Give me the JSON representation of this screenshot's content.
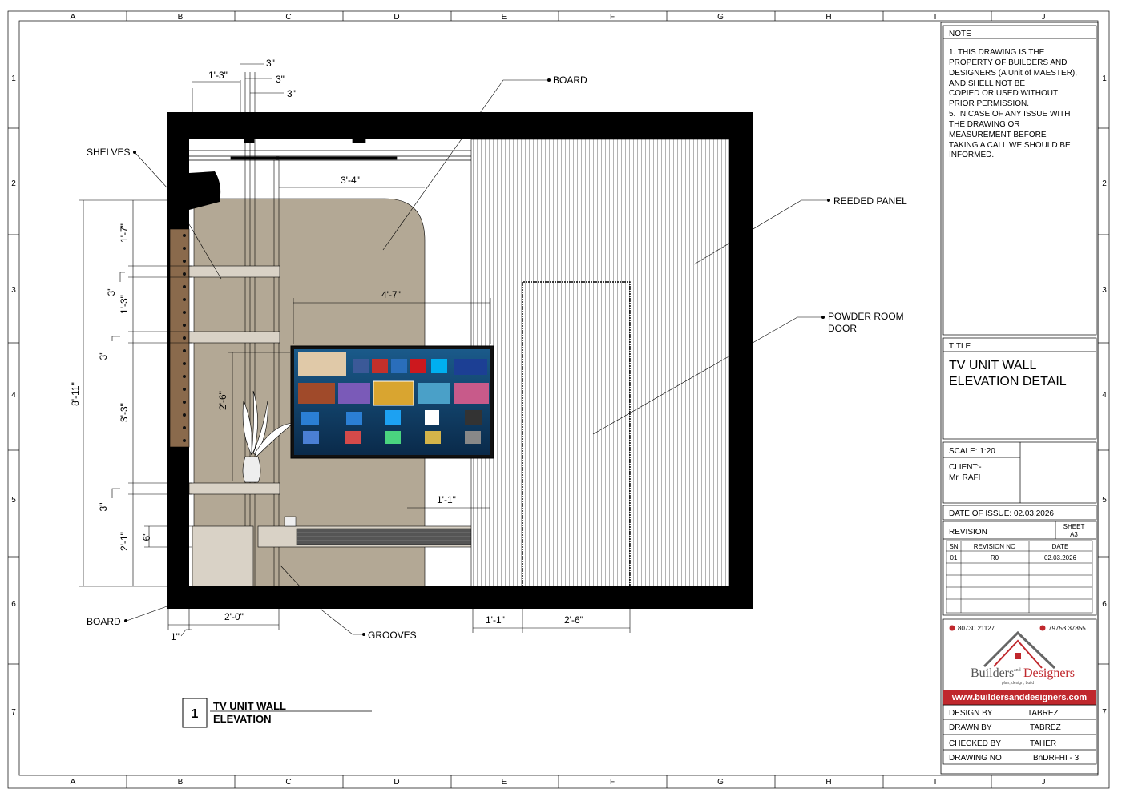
{
  "grid": {
    "columns": [
      "A",
      "B",
      "C",
      "D",
      "E",
      "F",
      "G",
      "H",
      "I",
      "J"
    ],
    "rows": [
      "1",
      "2",
      "3",
      "4",
      "5",
      "6",
      "7"
    ]
  },
  "note": {
    "heading": "NOTE",
    "lines": [
      "1. THIS DRAWING IS THE",
      "PROPERTY OF BUILDERS AND",
      "DESIGNERS (A Unit of MAESTER),",
      "AND SHELL NOT BE",
      "COPIED OR USED WITHOUT",
      "PRIOR PERMISSION.",
      "5. IN CASE OF ANY ISSUE WITH",
      "THE DRAWING OR",
      "MEASUREMENT BEFORE",
      "TAKING A CALL WE SHOULD BE",
      "INFORMED."
    ]
  },
  "title_block": {
    "title_heading": "TITLE",
    "title_line1": "TV UNIT WALL",
    "title_line2": "ELEVATION DETAIL",
    "scale": "SCALE:  1:20",
    "client_label": "CLIENT:-",
    "client_name": "Mr. RAFI",
    "date_of_issue": "DATE OF ISSUE:  02.03.2026",
    "revision_label": "REVISION",
    "sheet_label": "SHEET",
    "sheet_value": "A3",
    "revision_table": {
      "headers": [
        "SN",
        "REVISION NO",
        "DATE"
      ],
      "rows": [
        [
          "01",
          "R0",
          "02.03.2026"
        ]
      ]
    },
    "phone_left": "80730 21127",
    "phone_right": "79753 37855",
    "logo_text_builders": "Builders",
    "logo_text_and": "and",
    "logo_text_designers": "Designers",
    "logo_tagline": "plan, design, build",
    "website": "www.buildersanddesigners.com",
    "design_by_label": "DESIGN BY",
    "design_by": "TABREZ",
    "drawn_by_label": "DRAWN BY",
    "drawn_by": "TABREZ",
    "checked_by_label": "CHECKED BY",
    "checked_by": "TAHER",
    "drawing_no_label": "DRAWING NO",
    "drawing_no": "BnDRFHI - 3",
    "brand_red": "#c0282d"
  },
  "drawing": {
    "view_number": "1",
    "view_title_line1": "TV UNIT WALL",
    "view_title_line2": "ELEVATION",
    "labels": {
      "board_top": "BOARD",
      "shelves": "SHELVES",
      "reeded_panel": "REEDED PANEL",
      "powder_room_door_1": "POWDER ROOM",
      "powder_room_door_2": "DOOR",
      "board_bottom": "BOARD",
      "grooves": "GROOVES"
    },
    "dimensions": {
      "d_1_3": "1'-3\"",
      "d_3a": "3\"",
      "d_3b": "3\"",
      "d_3c": "3\"",
      "d_3_4": "3'-4\"",
      "d_8_11": "8'-11\"",
      "d_1_7": "1'-7\"",
      "d_3d": "3\"",
      "d_1_3v": "1'-3\"",
      "d_3e": "3\"",
      "d_3_3": "3'-3\"",
      "d_3f": "3\"",
      "d_2_1": "2'-1\"",
      "d_6": "6\"",
      "d_2_6v": "2'-6\"",
      "d_4_7": "4'-7\"",
      "d_1_1": "1'-1\"",
      "d_2_0": "2'-0\"",
      "d_1in": "1\"",
      "d_1_1b": "1'-1\"",
      "d_2_6b": "2'-6\""
    },
    "colors": {
      "wall": "#000000",
      "panel_board": "#b3a895",
      "shelf": "#d9d2c6",
      "wood": "#8a6a4c"
    }
  }
}
